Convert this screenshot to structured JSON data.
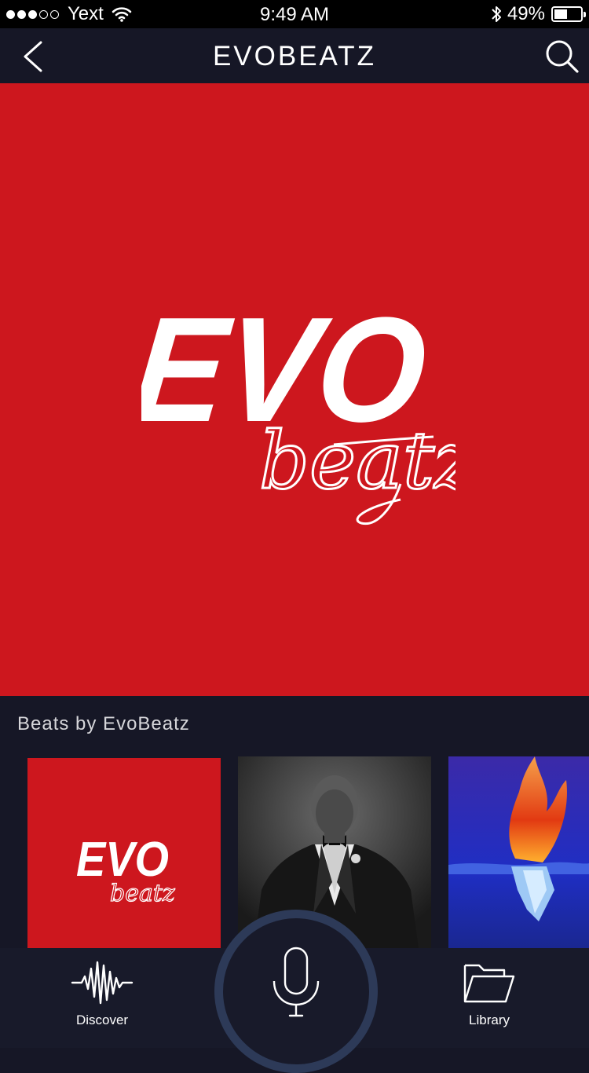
{
  "status_bar": {
    "carrier": "Yext",
    "time": "9:49 AM",
    "battery": "49%",
    "battery_level": 0.49,
    "signal_bars": 3,
    "signal_total": 5
  },
  "nav": {
    "title": "EVOBEATZ",
    "back_icon": "chevron-left-icon",
    "search_icon": "search-icon"
  },
  "hero": {
    "logo_top": "EVO",
    "logo_bottom": "beatz",
    "background": "#cd171e"
  },
  "section": {
    "title": "Beats by EvoBeatz"
  },
  "cards": [
    {
      "logo_top": "EVO",
      "logo_bottom": "beatz"
    },
    {},
    {}
  ],
  "tab_bar": {
    "discover_label": "Discover",
    "library_label": "Library",
    "mic_icon": "microphone-icon",
    "accent": "#2d3a58"
  }
}
